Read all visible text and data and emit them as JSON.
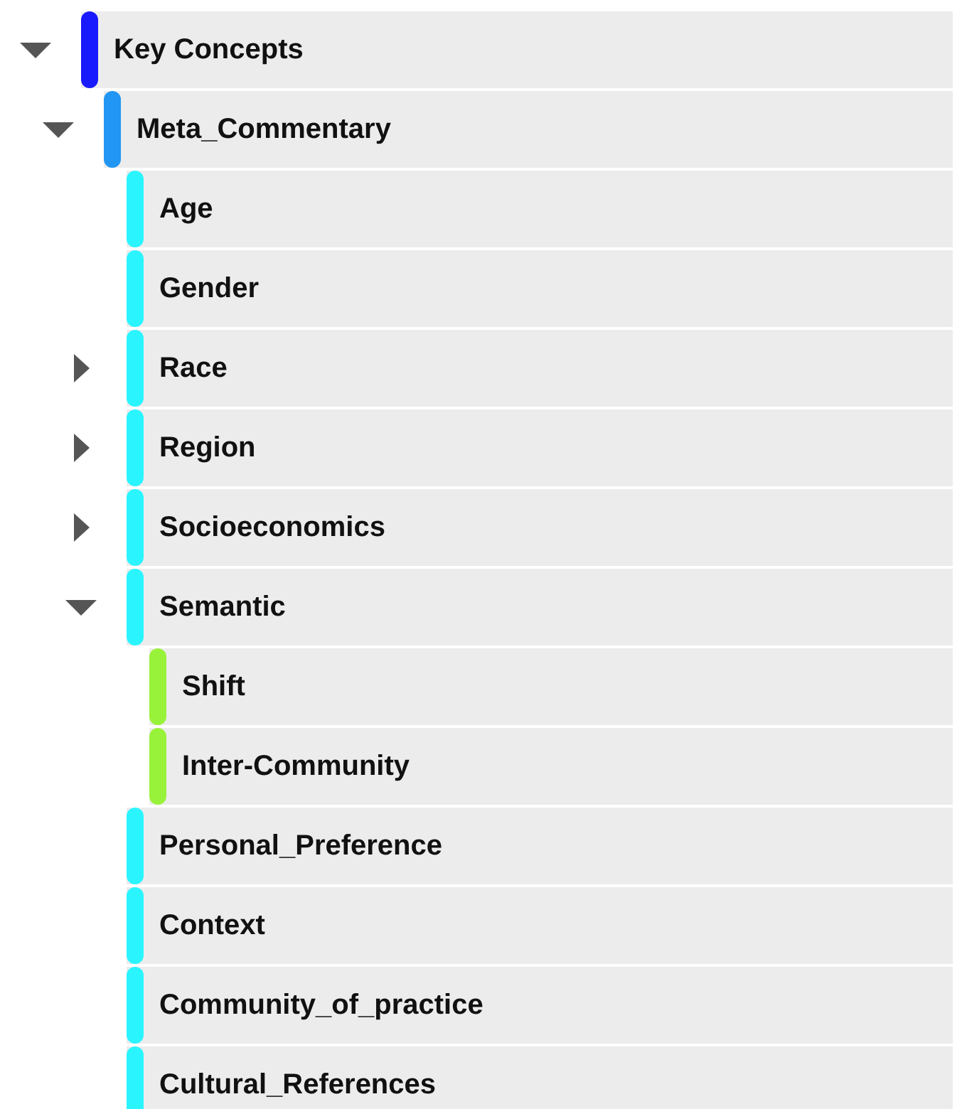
{
  "tree": [
    {
      "label": "Key Concepts",
      "color": "#1a1aff",
      "expanded": true,
      "children": [
        {
          "label": "Meta_Commentary",
          "color": "#2196f3",
          "expanded": true,
          "children": [
            {
              "label": "Age",
              "color": "#2af5ff"
            },
            {
              "label": "Gender",
              "color": "#2af5ff"
            },
            {
              "label": "Race",
              "color": "#2af5ff",
              "expanded": false
            },
            {
              "label": "Region",
              "color": "#2af5ff",
              "expanded": false
            },
            {
              "label": "Socioeconomics",
              "color": "#2af5ff",
              "expanded": false
            },
            {
              "label": "Semantic",
              "color": "#2af5ff",
              "expanded": true,
              "children": [
                {
                  "label": "Shift",
                  "color": "#99f23a"
                },
                {
                  "label": "Inter-Community",
                  "color": "#99f23a"
                }
              ]
            },
            {
              "label": "Personal_Preference",
              "color": "#2af5ff"
            },
            {
              "label": "Context",
              "color": "#2af5ff"
            },
            {
              "label": "Community_of_practice",
              "color": "#2af5ff"
            },
            {
              "label": "Cultural_References",
              "color": "#2af5ff"
            }
          ]
        }
      ]
    }
  ]
}
